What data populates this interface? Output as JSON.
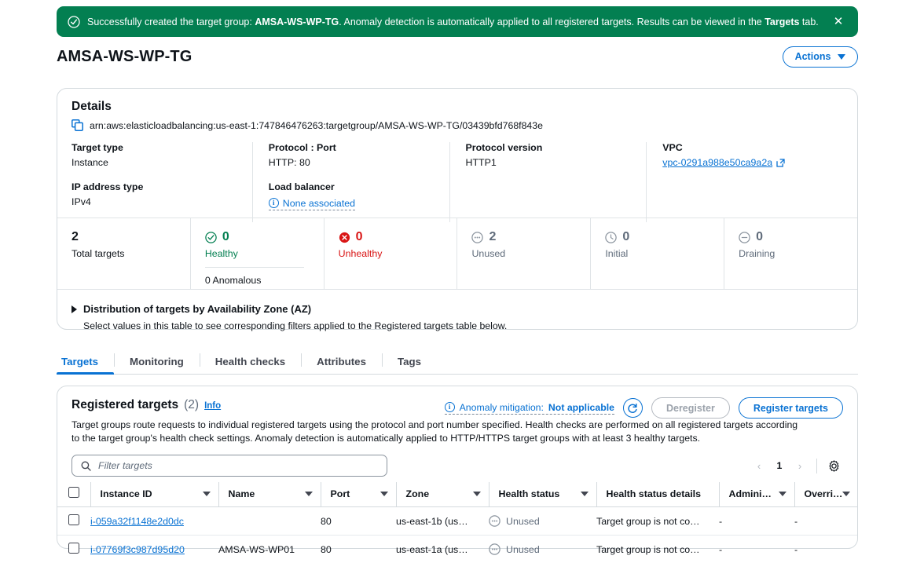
{
  "flash": {
    "icon": "check-circle-icon",
    "prefix": "Successfully created the target group: ",
    "target_group": "AMSA-WS-WP-TG",
    "middle": ". Anomaly detection is automatically applied to all registered targets. Results can be viewed in the ",
    "tab_name": "Targets",
    "suffix": " tab.",
    "close_label": "✕",
    "bg_color": "#037f51"
  },
  "header": {
    "title": "AMSA-WS-WP-TG",
    "actions_label": "Actions"
  },
  "details": {
    "title": "Details",
    "arn": "arn:aws:elasticloadbalancing:us-east-1:747846476263:targetgroup/AMSA-WS-WP-TG/03439bfd768f843e",
    "fields": [
      {
        "label": "Target type",
        "value": "Instance"
      },
      {
        "label": "IP address type",
        "value": "IPv4"
      },
      {
        "label": "Protocol : Port",
        "value": "HTTP: 80"
      },
      {
        "label": "Load balancer",
        "value": "None associated"
      },
      {
        "label": "Protocol version",
        "value": "HTTP1"
      },
      {
        "label": "VPC",
        "value": "vpc-0291a988e50ca9a2a"
      }
    ]
  },
  "metrics": [
    {
      "value": "2",
      "label": "Total targets",
      "icon": "none",
      "color": "#0f141a"
    },
    {
      "value": "0",
      "label": "Healthy",
      "icon": "check-circle-icon",
      "color": "#037f51",
      "sub": "0 Anomalous"
    },
    {
      "value": "0",
      "label": "Unhealthy",
      "icon": "error-circle-icon",
      "color": "#d91515"
    },
    {
      "value": "2",
      "label": "Unused",
      "icon": "dots-circle-icon",
      "color": "#5f6b7a"
    },
    {
      "value": "0",
      "label": "Initial",
      "icon": "clock-circle-icon",
      "color": "#5f6b7a"
    },
    {
      "value": "0",
      "label": "Draining",
      "icon": "minus-circle-icon",
      "color": "#5f6b7a"
    }
  ],
  "az": {
    "title": "Distribution of targets by Availability Zone (AZ)",
    "description": "Select values in this table to see corresponding filters applied to the Registered targets table below."
  },
  "tabs": [
    {
      "label": "Targets",
      "active": true
    },
    {
      "label": "Monitoring",
      "active": false
    },
    {
      "label": "Health checks",
      "active": false
    },
    {
      "label": "Attributes",
      "active": false
    },
    {
      "label": "Tags",
      "active": false
    }
  ],
  "registered": {
    "title": "Registered targets",
    "count": "(2)",
    "info_label": "Info",
    "description": "Target groups route requests to individual registered targets using the protocol and port number specified. Health checks are performed on all registered targets according to the target group's health check settings. Anomaly detection is automatically applied to HTTP/HTTPS target groups with at least 3 healthy targets.",
    "anomaly_prefix": "Anomaly mitigation: ",
    "anomaly_value": "Not applicable",
    "refresh_icon": "refresh-icon",
    "deregister_label": "Deregister",
    "register_label": "Register targets",
    "filter_placeholder": "Filter targets",
    "filter_value": "",
    "page_number": "1",
    "prev_label": "‹",
    "next_label": "›",
    "settings_icon": "gear-icon",
    "columns": [
      "Instance ID",
      "Name",
      "Port",
      "Zone",
      "Health status",
      "Health status details",
      "Admini…",
      "Overri…"
    ],
    "rows": [
      {
        "instance_id": "i-059a32f1148e2d0dc",
        "name": "",
        "port": "80",
        "zone": "us-east-1b (us…",
        "health_status": "Unused",
        "health_details": "Target group is not co…",
        "administrative": "-",
        "override": "-"
      },
      {
        "instance_id": "i-07769f3c987d95d20",
        "name": "AMSA-WS-WP01",
        "port": "80",
        "zone": "us-east-1a (us…",
        "health_status": "Unused",
        "health_details": "Target group is not co…",
        "administrative": "-",
        "override": "-"
      }
    ]
  },
  "colors": {
    "link": "#0972d3",
    "success": "#037f51",
    "error": "#d91515",
    "muted": "#5f6b7a",
    "border": "#d4dade"
  }
}
